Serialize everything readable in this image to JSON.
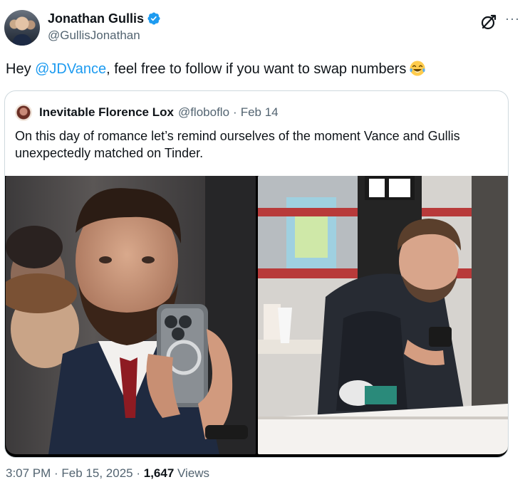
{
  "author": {
    "display_name": "Jonathan Gullis",
    "handle": "@GullisJonathan",
    "verified": true
  },
  "tweet": {
    "text_before": "Hey ",
    "mention": "@JDVance",
    "text_after": ", feel free to follow if you want to swap numbers",
    "emoji": "face-with-tears-of-joy"
  },
  "quote": {
    "display_name": "Inevitable Florence Lox",
    "handle": "@floboflo",
    "separator": "·",
    "date": "Feb 14",
    "text": "On this day of romance let’s remind ourselves of the moment Vance and Gullis unexpectedly matched on Tinder.",
    "photos": [
      {
        "subject": "man-with-beard-taking-mirror-selfie"
      },
      {
        "subject": "man-looking-at-phone-in-restaurant"
      }
    ]
  },
  "meta": {
    "time": "3:07 PM",
    "sep1": " · ",
    "date": "Feb 15, 2025",
    "sep2": " · ",
    "views_count": "1,647",
    "views_label": " Views"
  },
  "colors": {
    "link": "#1d9bf0",
    "secondary_text": "#536471",
    "primary_text": "#0f1419",
    "border": "#cfd9de"
  }
}
